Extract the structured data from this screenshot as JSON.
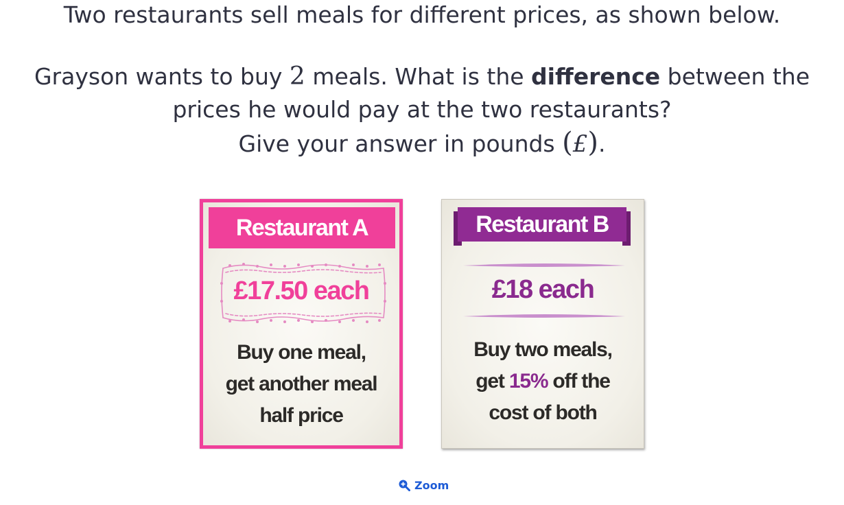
{
  "question": {
    "line1": "Two restaurants sell meals for different prices, as shown below.",
    "line2_pre": "Grayson wants to buy ",
    "line2_num": "2",
    "line2_mid": " meals. What is the ",
    "line2_bold": "difference",
    "line2_post": " between the",
    "line3": "prices he would pay at the two restaurants?",
    "line4_pre": "Give your answer in pounds ",
    "line4_open": "(",
    "line4_symbol": "£",
    "line4_close": ")",
    "line4_end": "."
  },
  "restaurant_a": {
    "name": "Restaurant A",
    "price": "£17.50 each",
    "offer_line1": "Buy one meal,",
    "offer_line2": "get another meal",
    "offer_line3": "half price",
    "color": "#f0409a"
  },
  "restaurant_b": {
    "name": "Restaurant B",
    "price": "£18 each",
    "offer_line1": "Buy two meals,",
    "offer_line2_pre": "get ",
    "offer_line2_accent": "15%",
    "offer_line2_post": " off the",
    "offer_line3": "cost of both",
    "color": "#902b93"
  },
  "zoom": {
    "label": "Zoom",
    "icon": "zoom-in-icon"
  }
}
